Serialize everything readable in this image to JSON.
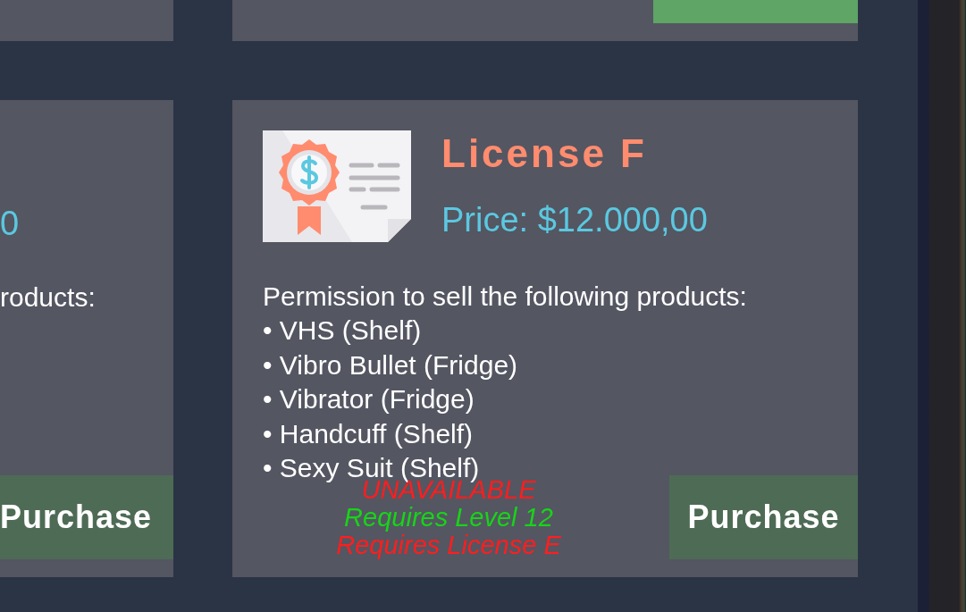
{
  "cards": [
    {
      "kind": "top-left"
    },
    {
      "kind": "top-right",
      "purchase_button": {
        "available": true
      }
    },
    {
      "kind": "bottom-left",
      "price": "0",
      "description": "roducts:",
      "purchase_button": {
        "label": "Purchase",
        "available": false
      }
    },
    {
      "kind": "bottom-right",
      "title": "License F",
      "price": "Price: $12.000,00",
      "description": "Permission to sell the following products:",
      "products": [
        "• VHS (Shelf)",
        "• Vibro Bullet (Fridge)",
        "• Vibrator (Fridge)",
        "• Handcuff (Shelf)",
        "• Sexy Suit (Shelf)"
      ],
      "status": "UNAVAILABLE",
      "requirements": [
        {
          "text": "Requires Level 12",
          "met": true
        },
        {
          "text": "Requires License E",
          "met": false
        }
      ],
      "purchase_button": {
        "label": "Purchase",
        "available": false
      }
    }
  ]
}
